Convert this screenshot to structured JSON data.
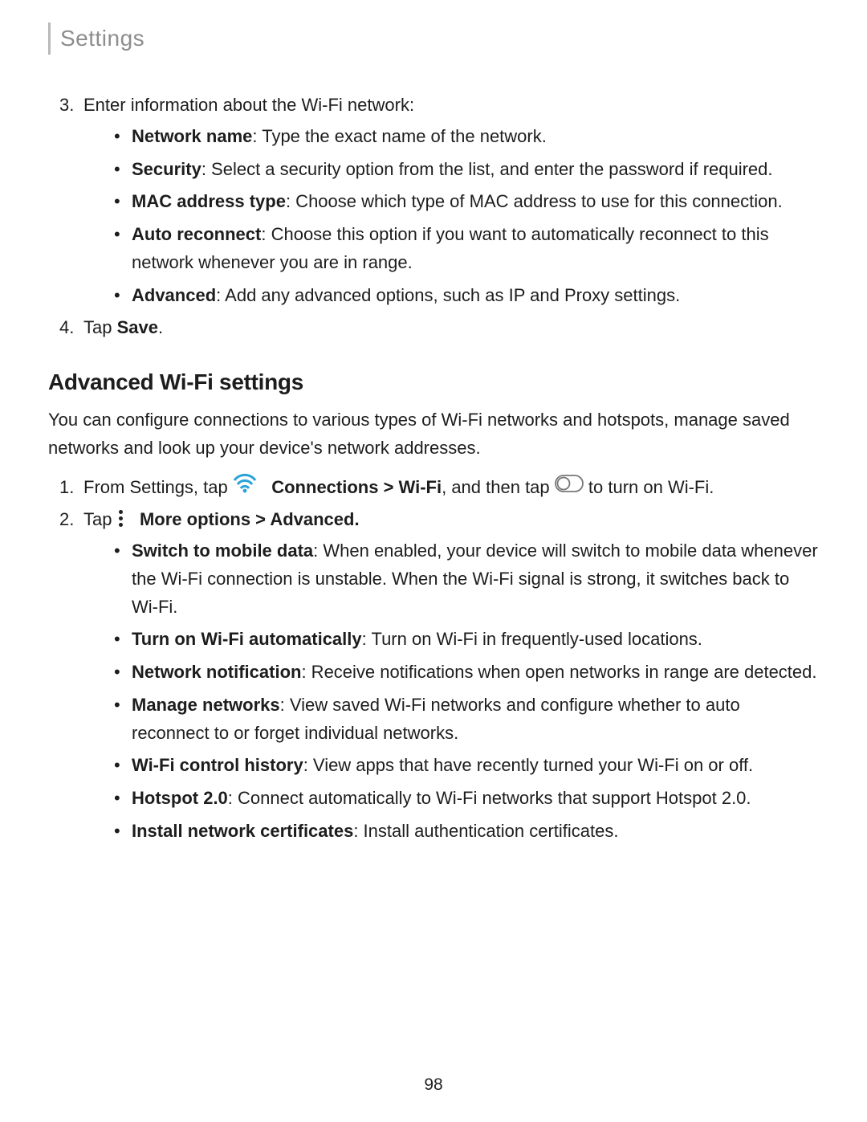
{
  "header": {
    "section_title": "Settings"
  },
  "page_number": "98",
  "section1": {
    "step3": {
      "num": "3.",
      "text": "Enter information about the Wi-Fi network:",
      "bullets": [
        {
          "label": "Network name",
          "desc": ": Type the exact name of the network."
        },
        {
          "label": "Security",
          "desc": ": Select a security option from the list, and enter the password if required."
        },
        {
          "label": "MAC address type",
          "desc": ": Choose which type of MAC address to use for this connection."
        },
        {
          "label": "Auto reconnect",
          "desc": ": Choose this option if you want to automatically reconnect to this network whenever you are in range."
        },
        {
          "label": "Advanced",
          "desc": ": Add any advanced options, such as IP and Proxy settings."
        }
      ]
    },
    "step4": {
      "num": "4.",
      "prefix": "Tap ",
      "bold": "Save",
      "suffix": "."
    }
  },
  "section2": {
    "heading": "Advanced Wi-Fi settings",
    "intro": "You can configure connections to various types of Wi-Fi networks and hotspots, manage saved networks and look up your device's network addresses.",
    "step1": {
      "num": "1.",
      "pre": "From Settings, tap ",
      "bold1": "Connections > Wi-Fi",
      "mid": ", and then tap ",
      "post": " to turn on Wi-Fi."
    },
    "step2": {
      "num": "2.",
      "pre": "Tap ",
      "bold": "More options > Advanced.",
      "bullets": [
        {
          "label": "Switch to mobile data",
          "desc": ": When enabled, your device will switch to mobile data whenever the Wi-Fi connection is unstable. When the Wi-Fi signal is strong, it switches back to Wi-Fi."
        },
        {
          "label": "Turn on Wi-Fi automatically",
          "desc": ": Turn on Wi-Fi in frequently-used locations."
        },
        {
          "label": "Network notification",
          "desc": ": Receive notifications when open networks in range are detected."
        },
        {
          "label": "Manage networks",
          "desc": ": View saved Wi-Fi networks and configure whether to auto reconnect to or forget individual networks."
        },
        {
          "label": "Wi-Fi control history",
          "desc": ": View apps that have recently turned your Wi-Fi on or off."
        },
        {
          "label": "Hotspot 2.0",
          "desc": ": Connect automatically to Wi-Fi networks that support Hotspot 2.0."
        },
        {
          "label": "Install network certificates",
          "desc": ": Install authentication certificates."
        }
      ]
    }
  }
}
